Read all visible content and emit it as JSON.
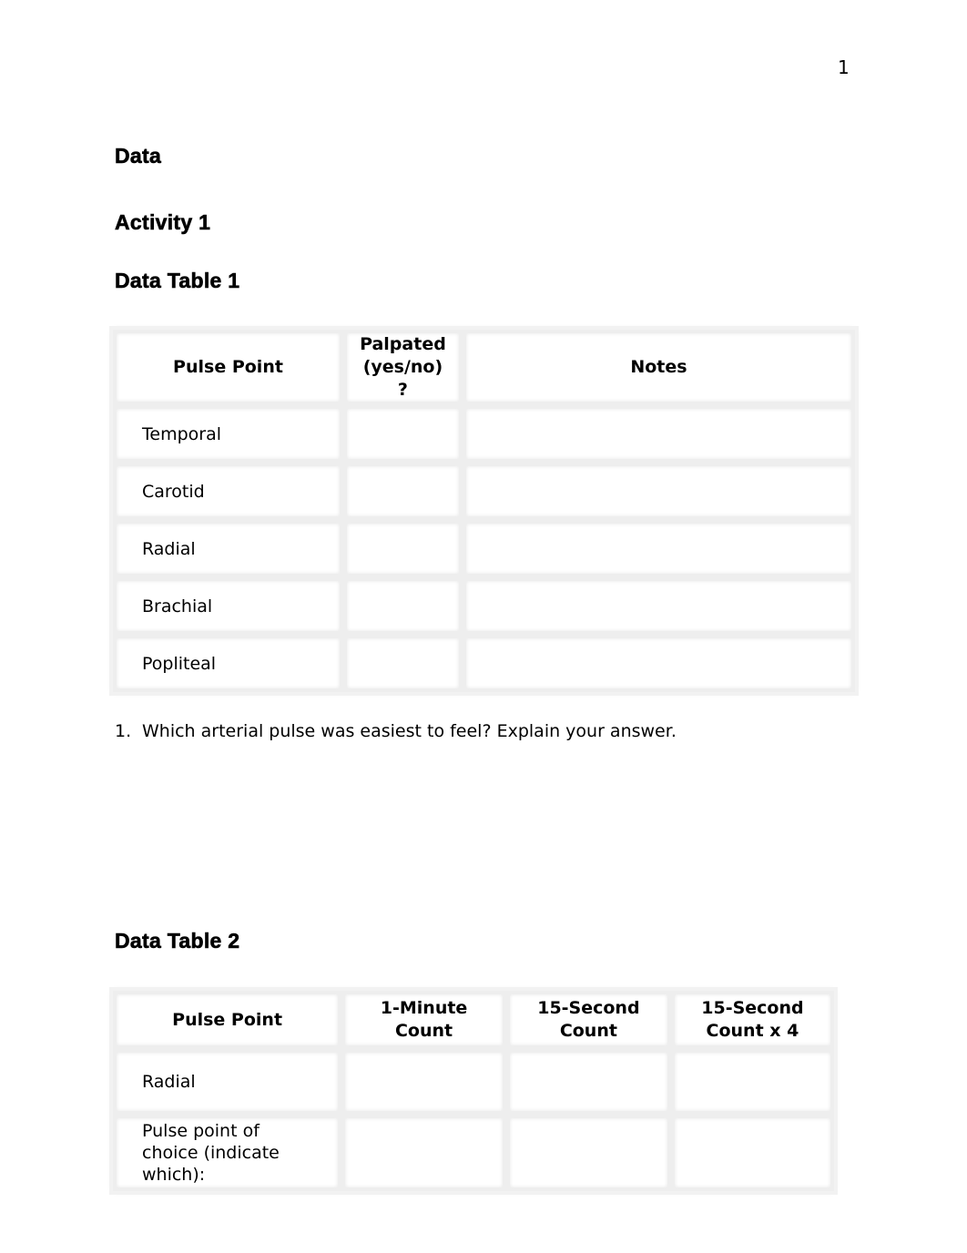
{
  "page_number": "1",
  "headings": {
    "data": "Data",
    "activity": "Activity 1",
    "table1_title": "Data Table 1",
    "table2_title": "Data Table 2"
  },
  "table1": {
    "headers": [
      "Pulse Point",
      "Palpated (yes/no)?",
      "Notes"
    ],
    "header_lines": {
      "palpated_line1": "Palpated",
      "palpated_line2": "(yes/no)",
      "palpated_line3": "?"
    },
    "rows": [
      {
        "pulse_point": "Temporal",
        "palpated": "",
        "notes": ""
      },
      {
        "pulse_point": "Carotid",
        "palpated": "",
        "notes": ""
      },
      {
        "pulse_point": "Radial",
        "palpated": "",
        "notes": ""
      },
      {
        "pulse_point": "Brachial",
        "palpated": "",
        "notes": ""
      },
      {
        "pulse_point": "Popliteal",
        "palpated": "",
        "notes": ""
      }
    ]
  },
  "question1": {
    "number": "1.",
    "text": "Which arterial pulse was easiest to feel? Explain your answer.",
    "answer": ""
  },
  "table2": {
    "headers": [
      "Pulse Point",
      "1-Minute Count",
      "15-Second Count",
      "15-Second Count x 4"
    ],
    "header_lines": {
      "col2_line1": "1-Minute",
      "col2_line2": "Count",
      "col3_line1": "15-Second",
      "col3_line2": "Count",
      "col4_line1": "15-Second",
      "col4_line2": "Count x 4"
    },
    "rows": [
      {
        "pulse_point": "Radial",
        "one_minute": "",
        "fifteen_second": "",
        "fifteen_second_x4": ""
      },
      {
        "pulse_point": "Pulse point of choice (indicate which):",
        "one_minute": "",
        "fifteen_second": "",
        "fifteen_second_x4": ""
      }
    ]
  }
}
